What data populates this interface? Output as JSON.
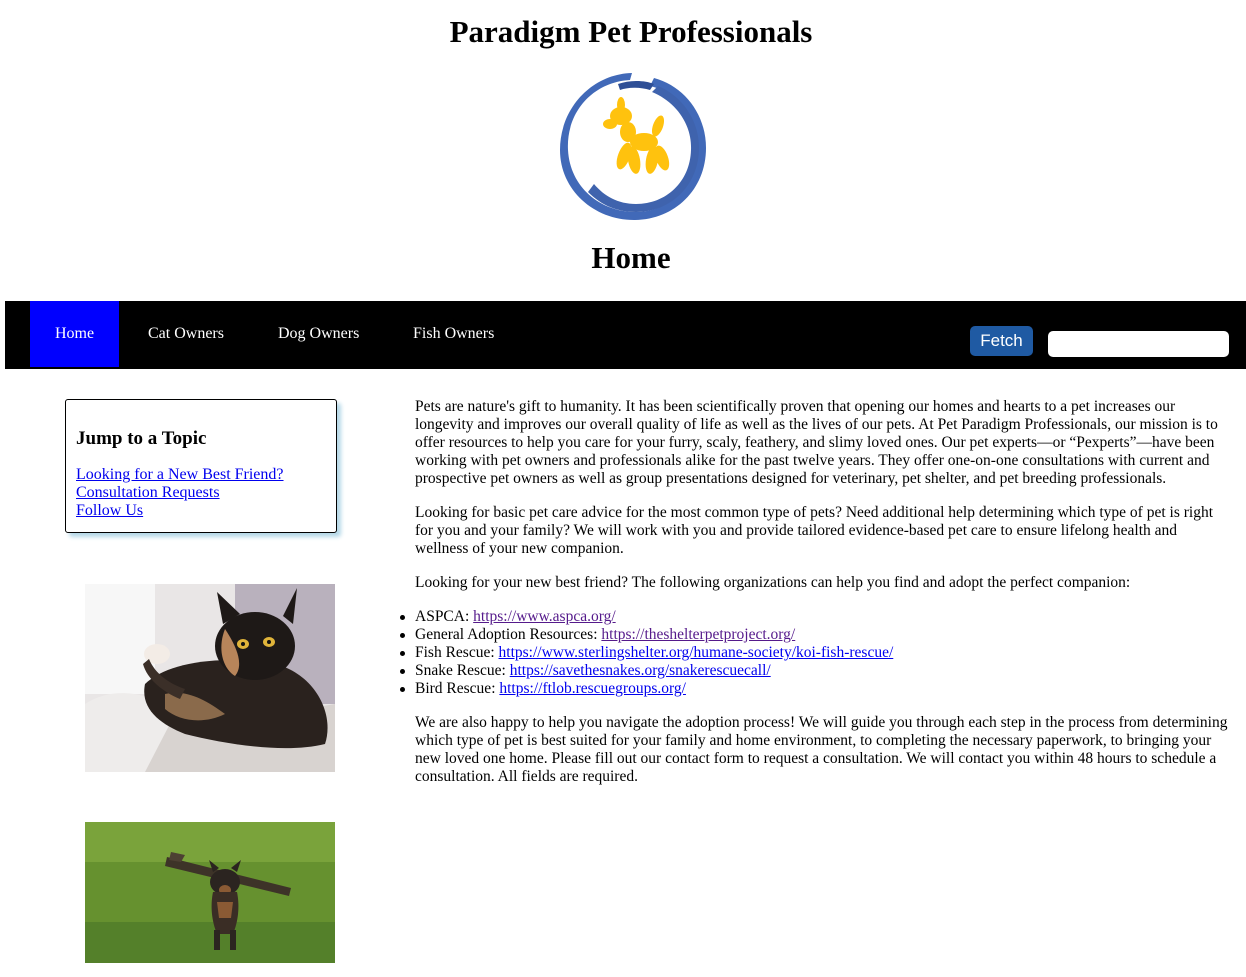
{
  "header": {
    "site_title": "Paradigm Pet Professionals",
    "page_heading": "Home",
    "logo_icon": "balloon-dog-logo-icon",
    "logo_colors": {
      "ring": "#4169b8",
      "dog": "#ffc20e"
    }
  },
  "nav": {
    "items": [
      {
        "label": "Home",
        "active": true
      },
      {
        "label": "Cat Owners",
        "active": false
      },
      {
        "label": "Dog Owners",
        "active": false
      },
      {
        "label": "Fish Owners",
        "active": false
      }
    ],
    "fetch_label": "Fetch",
    "search_value": "",
    "active_color": "#0000ff",
    "bar_color": "#000000"
  },
  "sidebar": {
    "topic_title": "Jump to a Topic",
    "topic_links": [
      "Looking for a New Best Friend?",
      "Consultation Requests",
      "Follow Us"
    ]
  },
  "main": {
    "paragraphs": [
      "Pets are nature's gift to humanity. It has been scientifically proven that opening our homes and hearts to a pet increases our longevity and improves our overall quality of life as well as the lives of our pets. At Pet Paradigm Professionals, our mission is to offer resources to help you care for your furry, scaly, feathery, and slimy loved ones. Our pet experts—or “Pexperts”—have been working with pet owners and professionals alike for the past twelve years. They offer one-on-one consultations with current and prospective pet owners as well as group presentations designed for veterinary, pet shelter, and pet breeding professionals.",
      "Looking for basic pet care advice for the most common type of pets? Need additional help determining which type of pet is right for you and your family? We will work with you and provide tailored evidence-based pet care to ensure lifelong health and wellness of your new companion.",
      "Looking for your new best friend? The following organizations can help you find and adopt the perfect companion:"
    ],
    "resources": [
      {
        "label": "ASPCA: ",
        "link": "https://www.aspca.org/"
      },
      {
        "label": "General Adoption Resources: ",
        "link": "https://theshelterpetproject.org/"
      },
      {
        "label": "Fish Rescue: ",
        "link": "https://www.sterlingshelter.org/humane-society/koi-fish-rescue/"
      },
      {
        "label": "Snake Rescue: ",
        "link": "https://savethesnakes.org/snakerescuecall/"
      },
      {
        "label": "Bird Rescue: ",
        "link": "https://ftlob.rescuegroups.org/"
      }
    ],
    "closing": "We are also happy to help you navigate the adoption process! We will guide you through each step in the process from determining which type of pet is best suited for your family and home environment, to completing the necessary paperwork, to bringing your new loved one home. Please fill out our contact form to request a consultation. We will contact you within 48 hours to schedule a consultation. All fields are required."
  }
}
